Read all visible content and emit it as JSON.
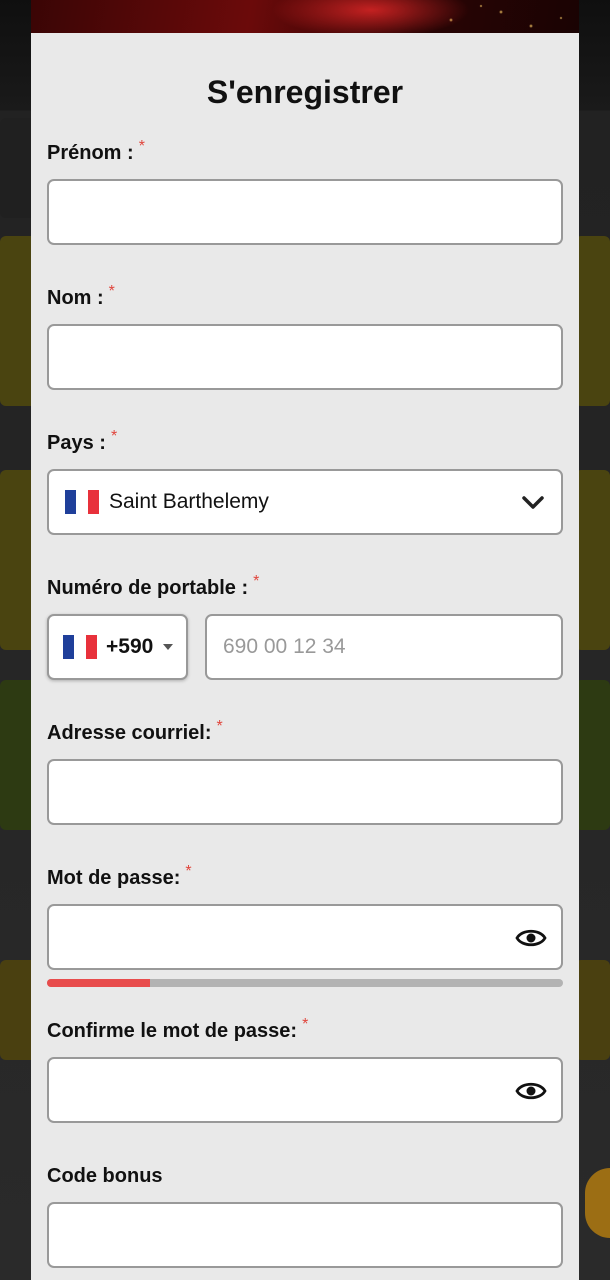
{
  "form": {
    "title": "S'enregistrer",
    "required_mark": "*",
    "first_name": {
      "label": "Prénom :",
      "value": ""
    },
    "last_name": {
      "label": "Nom :",
      "value": ""
    },
    "country": {
      "label": "Pays :",
      "selected": "Saint Barthelemy",
      "flag_icon": "france-flag-icon"
    },
    "mobile": {
      "label": "Numéro de portable :",
      "dial_code": "+590",
      "placeholder": "690 00 12 34",
      "value": ""
    },
    "email": {
      "label": "Adresse courriel:",
      "value": ""
    },
    "password": {
      "label": "Mot de passe:",
      "value": "",
      "strength_fraction": 0.2
    },
    "confirm_password": {
      "label": "Confirme le mot de passe:",
      "value": ""
    },
    "bonus_code": {
      "label": "Code bonus",
      "value": ""
    }
  },
  "colors": {
    "required": "#e0453c",
    "strength_weak": "#e84c4c",
    "strength_track": "#b3b3b3",
    "modal_bg": "#e9e9e9"
  }
}
